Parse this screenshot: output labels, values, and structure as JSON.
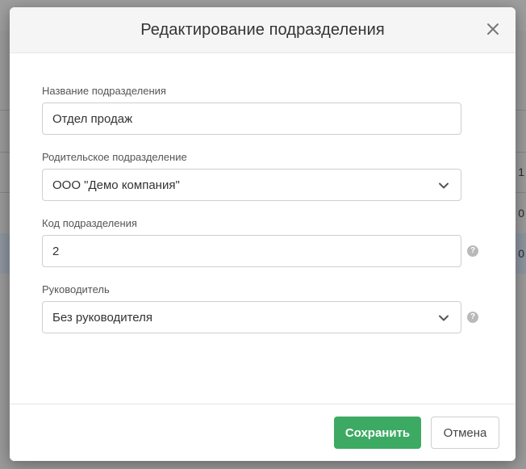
{
  "background": {
    "row_values": [
      "1",
      "0",
      "0"
    ]
  },
  "modal": {
    "title": "Редактирование подразделения",
    "close_icon": "close-icon"
  },
  "form": {
    "name": {
      "label": "Название подразделения",
      "value": "Отдел продаж"
    },
    "parent": {
      "label": "Родительское подразделение",
      "value": "ООО \"Демо компания\"",
      "icon": "chevron-down-icon"
    },
    "code": {
      "label": "Код подразделения",
      "value": "2",
      "help": "?"
    },
    "manager": {
      "label": "Руководитель",
      "value": "Без руководителя",
      "icon": "chevron-down-icon",
      "help": "?"
    }
  },
  "footer": {
    "save_label": "Сохранить",
    "cancel_label": "Отмена",
    "save_color": "#3daa63"
  }
}
